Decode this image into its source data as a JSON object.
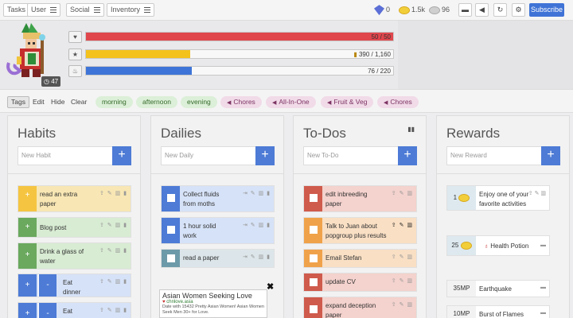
{
  "nav": {
    "items": [
      {
        "label": "Tasks",
        "x": 0
      },
      {
        "label": "User"
      },
      {
        "label": "Social"
      },
      {
        "label": "Inventory"
      }
    ],
    "currency": {
      "gems": "0",
      "gold": "1.5k",
      "silver": "96"
    },
    "subscribe_label": "Subscribe"
  },
  "header": {
    "level": "47",
    "health": {
      "value": "50 / 50",
      "fraction": 1.0,
      "color": "#e0474d"
    },
    "experience": {
      "value": "390 / 1,160",
      "fraction": 0.34,
      "color": "#f4c21c"
    },
    "mana": {
      "value": "76 / 220",
      "fraction": 0.345,
      "color": "#3e74d7"
    }
  },
  "tagbar": {
    "tabs": [
      "Tags",
      "Edit",
      "Hide",
      "Clear"
    ],
    "tags": [
      {
        "label": "morning",
        "kind": "time"
      },
      {
        "label": "afternoon",
        "kind": "time"
      },
      {
        "label": "evening",
        "kind": "time"
      },
      {
        "label": "Chores",
        "kind": "challenge"
      },
      {
        "label": "All-In-One",
        "kind": "challenge"
      },
      {
        "label": "Fruit & Veg",
        "kind": "challenge"
      },
      {
        "label": "Chores",
        "kind": "challenge"
      }
    ]
  },
  "habits": {
    "title": "Habits",
    "placeholder": "New Habit",
    "items": [
      {
        "text": "read an extra paper",
        "color": "#f8e7b4",
        "ctrl_color": "#f5c542"
      },
      {
        "text": "Blog post",
        "color": "#d8ecd3",
        "ctrl_color": "#6aa95e"
      },
      {
        "text": "Drink a glass of water",
        "color": "#d8ecd3",
        "ctrl_color": "#6aa95e"
      },
      {
        "text": "Eat dinner",
        "color": "#d6e2f7",
        "ctrl_color": "#4d7bd6"
      },
      {
        "text": "Eat",
        "color": "#d6e2f7",
        "ctrl_color": "#4d7bd6"
      }
    ]
  },
  "dailies": {
    "title": "Dailies",
    "placeholder": "New Daily",
    "items": [
      {
        "text": "Collect fluids from moths",
        "color": "#d6e2f7",
        "ctrl_color": "#4d7bd6"
      },
      {
        "text": "1 hour solid work",
        "color": "#d6e2f7",
        "ctrl_color": "#4d7bd6"
      },
      {
        "text": "read a paper",
        "color": "#dce6ea",
        "ctrl_color": "#6d9aa8"
      }
    ]
  },
  "todos": {
    "title": "To-Dos",
    "placeholder": "New To-Do",
    "items": [
      {
        "text": "edit inbreeding paper",
        "color": "#f4d2cd",
        "ctrl_color": "#cf5b4c"
      },
      {
        "text": "Talk to Juan about popgroup plus results",
        "color": "#f9dfc4",
        "ctrl_color": "#f0a24a"
      },
      {
        "text": "Email Stefan",
        "color": "#f9dfc4",
        "ctrl_color": "#f0a24a"
      },
      {
        "text": "update CV",
        "color": "#f4d2cd",
        "ctrl_color": "#cf5b4c"
      },
      {
        "text": "expand deception paper",
        "color": "#f4d2cd",
        "ctrl_color": "#cf5b4c"
      }
    ]
  },
  "rewards": {
    "title": "Rewards",
    "placeholder": "New Reward",
    "items": [
      {
        "cost": "1",
        "text": "Enjoy one of your favorite activities",
        "unit": "gold"
      },
      {
        "cost": "25",
        "text": "Health Potion",
        "unit": "gold"
      },
      {
        "cost": "35MP",
        "text": "Earthquake",
        "unit": "mp"
      },
      {
        "cost": "10MP",
        "text": "Burst of Flames",
        "unit": "mp"
      }
    ]
  },
  "ad": {
    "close": "✖",
    "title": "Asian Women Seeking Love",
    "url": "chnlove.asia",
    "desc": "Date with 15432 Pretty Asian Women! Asian Women Seek Men 30+ for Love."
  }
}
